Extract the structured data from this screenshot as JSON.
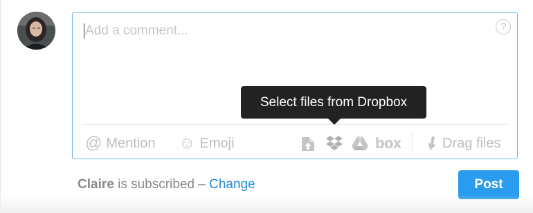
{
  "composer": {
    "placeholder": "Add a comment...",
    "help_symbol": "?",
    "tools": {
      "mention": {
        "symbol": "@",
        "label": "Mention"
      },
      "emoji": {
        "symbol": "☺",
        "label": "Emoji"
      },
      "upload": {
        "icon": "upload-file-icon"
      },
      "dropbox": {
        "icon": "dropbox-icon"
      },
      "google_drive": {
        "icon": "google-drive-icon"
      },
      "box": {
        "label": "box"
      },
      "drag_files": {
        "icon": "download-arrow-icon",
        "label": "Drag files"
      }
    },
    "tooltip": "Select files from Dropbox"
  },
  "footer": {
    "name": "Claire",
    "subscribed_text": " is subscribed – ",
    "change_label": "Change",
    "post_label": "Post"
  },
  "colors": {
    "accent": "#2a9cef",
    "link": "#1f8fd8",
    "focus_border": "#6fb6e8",
    "tooltip_bg": "#222222",
    "muted_text": "#bdbdbd"
  }
}
